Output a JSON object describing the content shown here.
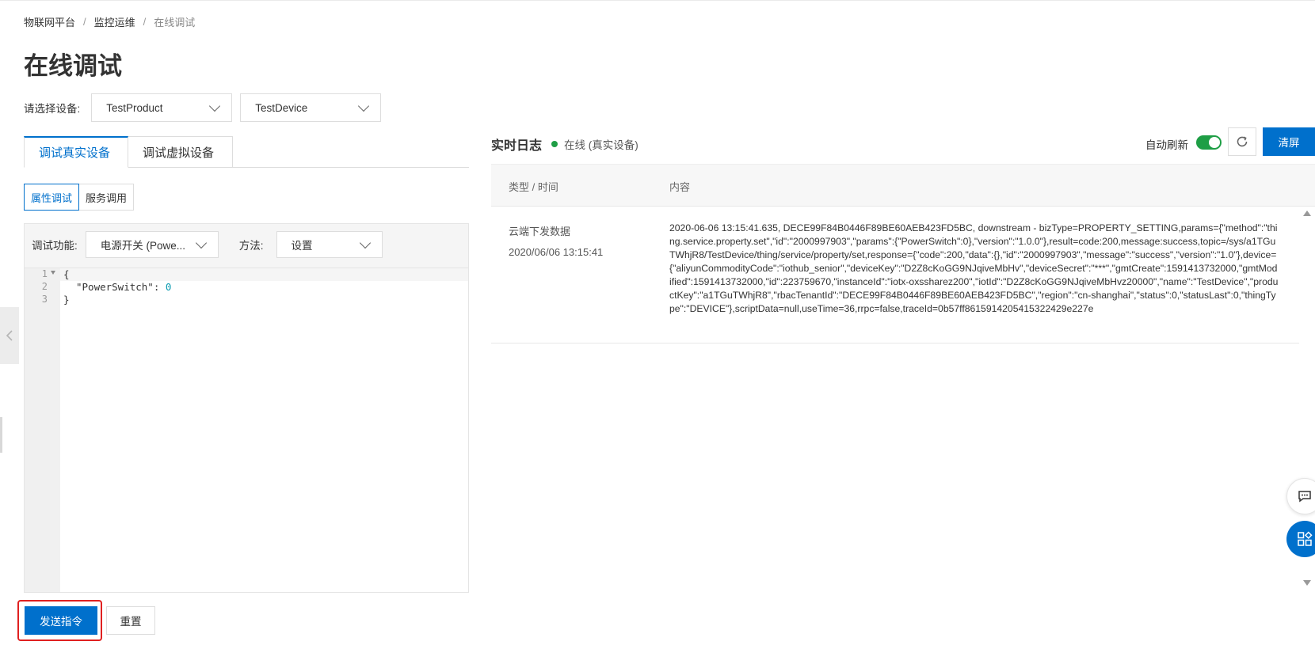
{
  "breadcrumb": {
    "items": [
      "物联网平台",
      "监控运维",
      "在线调试"
    ],
    "separator": "/"
  },
  "page": {
    "title": "在线调试"
  },
  "device_select": {
    "label": "请选择设备:",
    "product": "TestProduct",
    "device": "TestDevice"
  },
  "tabs": {
    "real": "调试真实设备",
    "virtual": "调试虚拟设备"
  },
  "subtabs": {
    "property": "属性调试",
    "service": "服务调用"
  },
  "debug": {
    "function_label": "调试功能:",
    "function_value": "电源开关 (Powe...",
    "method_label": "方法:",
    "method_value": "设置"
  },
  "editor": {
    "line_numbers": [
      "1",
      "2",
      "3"
    ],
    "line1": "{",
    "line2_key": "\"PowerSwitch\": ",
    "line2_value": "0",
    "line3": "}"
  },
  "actions": {
    "send": "发送指令",
    "reset": "重置"
  },
  "log": {
    "title": "实时日志",
    "status": "在线 (真实设备)",
    "auto_refresh_label": "自动刷新",
    "auto_refresh_on": true,
    "clear_label": "清屏",
    "columns": [
      "类型 / 时间",
      "内容"
    ],
    "rows": [
      {
        "type": "云端下发数据",
        "time": "2020/06/06 13:15:41",
        "content": "2020-06-06 13:15:41.635, DECE99F84B0446F89BE60AEB423FD5BC, downstream - bizType=PROPERTY_SETTING,params={\"method\":\"thing.service.property.set\",\"id\":\"2000997903\",\"params\":{\"PowerSwitch\":0},\"version\":\"1.0.0\"},result=code:200,message:success,topic=/sys/a1TGuTWhjR8/TestDevice/thing/service/property/set,response={\"code\":200,\"data\":{},\"id\":\"2000997903\",\"message\":\"success\",\"version\":\"1.0\"},device={\"aliyunCommodityCode\":\"iothub_senior\",\"deviceKey\":\"D2Z8cKoGG9NJqiveMbHv\",\"deviceSecret\":\"***\",\"gmtCreate\":1591413732000,\"gmtModified\":1591413732000,\"id\":223759670,\"instanceId\":\"iotx-oxssharez200\",\"iotId\":\"D2Z8cKoGG9NJqiveMbHvz20000\",\"name\":\"TestDevice\",\"productKey\":\"a1TGuTWhjR8\",\"rbacTenantId\":\"DECE99F84B0446F89BE60AEB423FD5BC\",\"region\":\"cn-shanghai\",\"status\":0,\"statusLast\":0,\"thingType\":\"DEVICE\"},scriptData=null,useTime=36,rrpc=false,traceId=0b57ff8615914205415322429e227e"
      }
    ]
  },
  "colors": {
    "primary": "#0070cc",
    "online": "#1e9e45",
    "highlight": "#e02020"
  },
  "icons": {
    "refresh": "refresh-icon",
    "chevron": "chevron-down-icon",
    "collapse": "chevron-left-icon",
    "chat": "chat-icon",
    "apps": "apps-grid-icon"
  }
}
